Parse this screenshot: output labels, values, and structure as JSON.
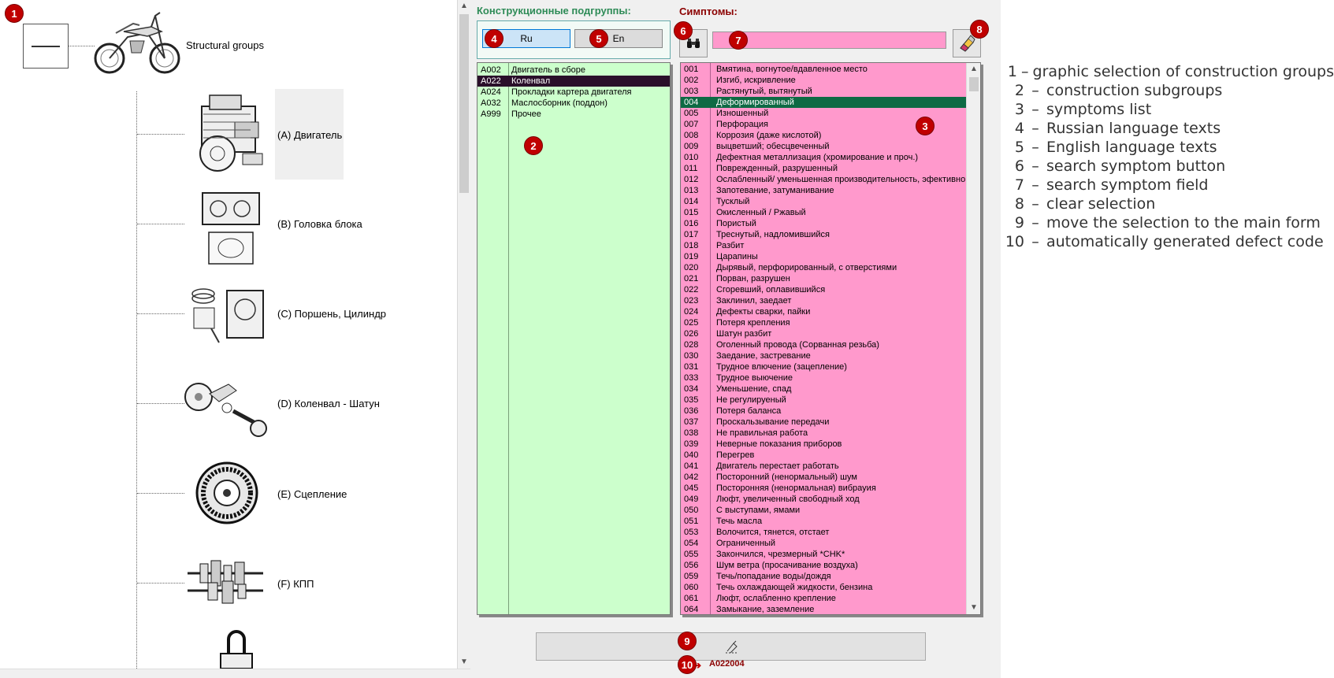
{
  "tree": {
    "root_label": "Structural groups",
    "nodes": [
      {
        "label": "(A) Двигатель"
      },
      {
        "label": "(B) Головка блока"
      },
      {
        "label": "(C) Поршень, Цилиндр"
      },
      {
        "label": "(D) Коленвал - Шатун"
      },
      {
        "label": "(E) Сцепление"
      },
      {
        "label": "(F) КПП"
      }
    ]
  },
  "subgroups": {
    "title": "Конструкционные подгруппы:",
    "title_color": "#2e8b57",
    "lang_ru": "Ru",
    "lang_en": "En",
    "selected_code": "A022",
    "items": [
      {
        "code": "A002",
        "name": "Двигатель в сборе"
      },
      {
        "code": "A022",
        "name": "Коленвал"
      },
      {
        "code": "A024",
        "name": "Прокладки картера двигателя"
      },
      {
        "code": "A032",
        "name": "Маслосборник (поддон)"
      },
      {
        "code": "A999",
        "name": "Прочее"
      }
    ]
  },
  "symptoms": {
    "title": "Симптомы:",
    "title_color": "#8b0000",
    "search_value": "",
    "selected_code": "004",
    "items": [
      {
        "code": "001",
        "name": "Вмятина, вогнутое/вдавленное место"
      },
      {
        "code": "002",
        "name": "Изгиб, искривление"
      },
      {
        "code": "003",
        "name": "Растянутый, вытянутый"
      },
      {
        "code": "004",
        "name": "Деформированный"
      },
      {
        "code": "005",
        "name": "Изношенный"
      },
      {
        "code": "007",
        "name": "Перфорация"
      },
      {
        "code": "008",
        "name": "Коррозия (даже кислотой)"
      },
      {
        "code": "009",
        "name": "выцветший; обесцвеченный"
      },
      {
        "code": "010",
        "name": "Дефектная металлизация (хромирование и проч.)"
      },
      {
        "code": "011",
        "name": "Поврежденный, разрушенный"
      },
      {
        "code": "012",
        "name": "Ослабленный/ уменьшенная производительность, эфективно"
      },
      {
        "code": "013",
        "name": "Запотевание, затуманивание"
      },
      {
        "code": "014",
        "name": "Тусклый"
      },
      {
        "code": "015",
        "name": "Окисленный / Ржавый"
      },
      {
        "code": "016",
        "name": "Пористый"
      },
      {
        "code": "017",
        "name": "Треснутый, надломившийся"
      },
      {
        "code": "018",
        "name": "Разбит"
      },
      {
        "code": "019",
        "name": "Царапины"
      },
      {
        "code": "020",
        "name": "Дырявый, перфорированный, с отверстиями"
      },
      {
        "code": "021",
        "name": "Порван, разрушен"
      },
      {
        "code": "022",
        "name": "Сгоревший, оплавившийся"
      },
      {
        "code": "023",
        "name": "Заклинил, заедает"
      },
      {
        "code": "024",
        "name": "Дефекты сварки, пайки"
      },
      {
        "code": "025",
        "name": "Потеря крепления"
      },
      {
        "code": "026",
        "name": "Шатун разбит"
      },
      {
        "code": "028",
        "name": "Оголенный провода   (Сорванная резьба)"
      },
      {
        "code": "030",
        "name": "Заедание, застревание"
      },
      {
        "code": "031",
        "name": "Трудное влючение (зацепление)"
      },
      {
        "code": "033",
        "name": "Трудное выючение"
      },
      {
        "code": "034",
        "name": "Уменьшение, спад"
      },
      {
        "code": "035",
        "name": "Не регулируеный"
      },
      {
        "code": "036",
        "name": "Потеря баланса"
      },
      {
        "code": "037",
        "name": "Проскальзывание передачи"
      },
      {
        "code": "038",
        "name": "Не правильная работа"
      },
      {
        "code": "039",
        "name": "Неверные показания приборов"
      },
      {
        "code": "040",
        "name": "Перегрев"
      },
      {
        "code": "041",
        "name": "Двигатель перестает работать"
      },
      {
        "code": "042",
        "name": "Посторонний (ненормальный) шум"
      },
      {
        "code": "045",
        "name": "Посторонняя (ненормальная) вибрауия"
      },
      {
        "code": "049",
        "name": "Люфт, увеличенный свободный ход"
      },
      {
        "code": "050",
        "name": "С выступами, ямами"
      },
      {
        "code": "051",
        "name": "Течь масла"
      },
      {
        "code": "053",
        "name": "Волочится, тянется, отстает"
      },
      {
        "code": "054",
        "name": "Ограниченный"
      },
      {
        "code": "055",
        "name": "Закончился, чрезмерный *CHK*"
      },
      {
        "code": "056",
        "name": "Шум ветра (просачивание воздуха)"
      },
      {
        "code": "059",
        "name": "Течь/попадание воды/дождя"
      },
      {
        "code": "060",
        "name": "Течь охлаждающей жидкости, бензина"
      },
      {
        "code": "061",
        "name": "Люфт, ослабленно крепление"
      },
      {
        "code": "064",
        "name": "Замыкание, заземление"
      }
    ]
  },
  "defect_code": "A022004",
  "badges": [
    "1",
    "2",
    "3",
    "4",
    "5",
    "6",
    "7",
    "8",
    "9",
    "10"
  ],
  "legend": [
    {
      "num": "1",
      "text": "graphic selection of construction groups"
    },
    {
      "num": "2",
      "text": "construction subgroups"
    },
    {
      "num": "3",
      "text": "symptoms list"
    },
    {
      "num": "4",
      "text": "Russian language texts"
    },
    {
      "num": "5",
      "text": "English language texts"
    },
    {
      "num": "6",
      "text": "search symptom button"
    },
    {
      "num": "7",
      "text": "search symptom field"
    },
    {
      "num": "8",
      "text": "clear selection"
    },
    {
      "num": "9",
      "text": "move the selection to the main form"
    },
    {
      "num": "10",
      "text": "automatically generated defect code"
    }
  ],
  "legend_separator": "–",
  "icons": {
    "search_button": "binoculars-icon",
    "clear_button": "eraser-icon",
    "move_button": "transfer-icon",
    "root": "collapse-box-icon"
  }
}
